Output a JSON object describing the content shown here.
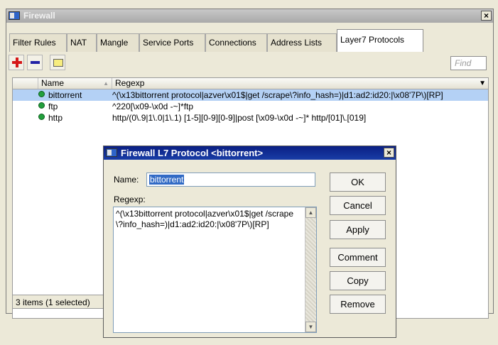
{
  "main_window": {
    "title": "Firewall",
    "close": "×",
    "tabs": [
      {
        "label": "Filter Rules"
      },
      {
        "label": "NAT"
      },
      {
        "label": "Mangle"
      },
      {
        "label": "Service Ports"
      },
      {
        "label": "Connections"
      },
      {
        "label": "Address Lists"
      },
      {
        "label": "Layer7 Protocols",
        "active": true
      }
    ],
    "toolbar": {
      "add_icon": "plus-icon",
      "remove_icon": "minus-icon",
      "comment_icon": "comment-icon",
      "find_placeholder": "Find"
    },
    "table": {
      "columns": [
        "Name",
        "Regexp"
      ],
      "sort_indicator": "▲",
      "menu_arrow": "▼",
      "rows": [
        {
          "name": "bittorrent",
          "regexp": "^(\\x13bittorrent protocol|azver\\x01$|get /scrape\\?info_hash=)|d1:ad2:id20:|\\x08'7P\\)[RP]",
          "selected": true
        },
        {
          "name": "ftp",
          "regexp": "^220[\\x09-\\x0d -~]*ftp",
          "selected": false
        },
        {
          "name": "http",
          "regexp": "http/(0\\.9|1\\.0|1\\.1) [1-5][0-9][0-9]|post [\\x09-\\x0d -~]* http/[01]\\.[019]",
          "selected": false
        }
      ]
    },
    "status": "3 items (1 selected)"
  },
  "dialog": {
    "title": "Firewall L7 Protocol <bittorrent>",
    "close": "×",
    "name_label": "Name:",
    "name_value": "bittorrent",
    "regexp_label": "Regexp:",
    "regexp_value": "^(\\x13bittorrent protocol|azver\\x01$|get /scrape\\?info_hash=)|d1:ad2:id20:|\\x08'7P\\)[RP]",
    "buttons": {
      "ok": "OK",
      "cancel": "Cancel",
      "apply": "Apply",
      "comment": "Comment",
      "copy": "Copy",
      "remove": "Remove"
    }
  },
  "colors": {
    "selected_row": "#b4d1f5",
    "status_dot": "#22a03c",
    "dialog_title": "#0a1f84"
  }
}
